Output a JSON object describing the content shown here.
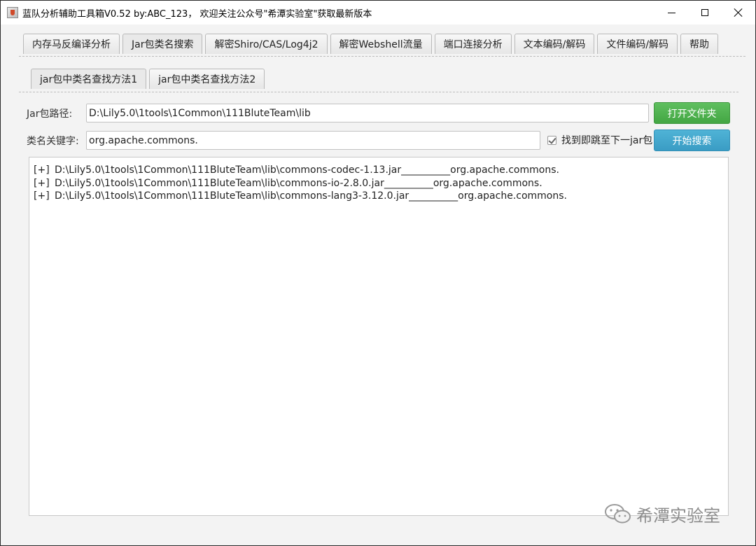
{
  "window": {
    "title": "蓝队分析辅助工具箱V0.52 by:ABC_123， 欢迎关注公众号\"希潭实验室\"获取最新版本"
  },
  "main_tabs": [
    {
      "label": "内存马反编译分析"
    },
    {
      "label": "Jar包类名搜索"
    },
    {
      "label": "解密Shiro/CAS/Log4j2"
    },
    {
      "label": "解密Webshell流量"
    },
    {
      "label": "端口连接分析"
    },
    {
      "label": "文本编码/解码"
    },
    {
      "label": "文件编码/解码"
    },
    {
      "label": "帮助"
    }
  ],
  "active_main_tab": 1,
  "sub_tabs": [
    {
      "label": "jar包中类名查找方法1"
    },
    {
      "label": "jar包中类名查找方法2"
    }
  ],
  "active_sub_tab": 0,
  "form": {
    "jar_path_label": "Jar包路径:",
    "jar_path_value": "D:\\Lily5.0\\1tools\\1Common\\111BluteTeam\\lib",
    "open_folder_button": "打开文件夹",
    "keyword_label": "类名关键字:",
    "keyword_value": "org.apache.commons.",
    "jump_checkbox_label": "找到即跳至下一jar包",
    "jump_checkbox_checked": true,
    "search_button": "开始搜索"
  },
  "results": [
    {
      "prefix": "[+]",
      "text": "D:\\Lily5.0\\1tools\\1Common\\111BluteTeam\\lib\\commons-codec-1.13.jar__________org.apache.commons."
    },
    {
      "prefix": "[+]",
      "text": "D:\\Lily5.0\\1tools\\1Common\\111BluteTeam\\lib\\commons-io-2.8.0.jar__________org.apache.commons."
    },
    {
      "prefix": "[+]",
      "text": "D:\\Lily5.0\\1tools\\1Common\\111BluteTeam\\lib\\commons-lang3-3.12.0.jar__________org.apache.commons."
    }
  ],
  "watermark": {
    "text": "希潭实验室",
    "icon": "wechat-icon"
  },
  "colors": {
    "green_button": "#4caf50",
    "blue_button": "#3fa7cf"
  }
}
